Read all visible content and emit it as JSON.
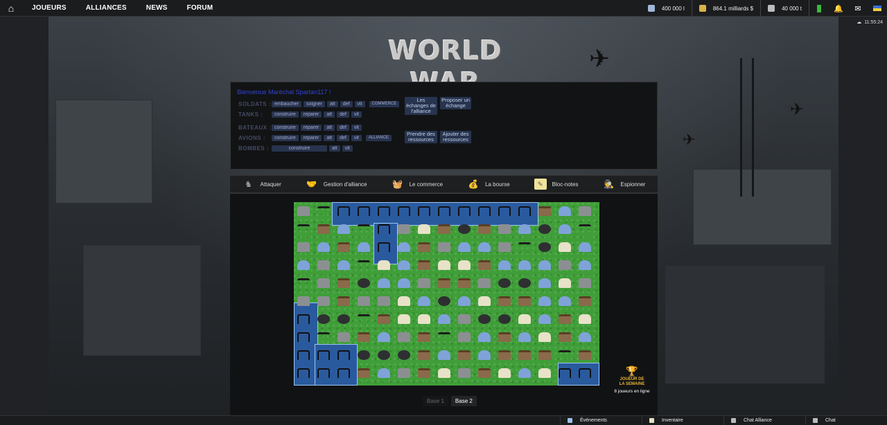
{
  "nav": {
    "home_label": "⌂",
    "items": [
      "JOUEURS",
      "ALLIANCES",
      "NEWS",
      "FORUM"
    ]
  },
  "resources": {
    "oil": "400 000 l",
    "money": "864.1 milliards $",
    "steel": "40 000 t"
  },
  "clock": "11:55:24",
  "logo_text": "WORLD WAR",
  "panel": {
    "welcome": "Bienvenue Maréchal Spartan117 !",
    "rows": {
      "soldats": {
        "label": "SOLDATS :",
        "buttons": [
          "embaucher",
          "soigner",
          "att",
          "def",
          "vit",
          "COMMERCE"
        ]
      },
      "tanks": {
        "label": "TANKS :",
        "buttons": [
          "construire",
          "reparer",
          "att",
          "def",
          "vit"
        ]
      },
      "bateaux": {
        "label": "BATEAUX :",
        "buttons": [
          "construire",
          "reparer",
          "att",
          "def",
          "vit"
        ]
      },
      "avions": {
        "label": "AVIONS :",
        "buttons": [
          "construire",
          "reparer",
          "att",
          "def",
          "vit",
          "ALLIANCE"
        ]
      },
      "bombes": {
        "label": "BOMBES :",
        "buttons": [
          "construire",
          "att",
          "vit"
        ]
      }
    },
    "side_buttons": {
      "echanges": "Les échanges de l'alliance",
      "proposer": "Proposer un échange",
      "prendre": "Prendre des ressources",
      "ajouter": "Ajouter des ressources"
    }
  },
  "actions": [
    "Attaquer",
    "Gestion d'alliance",
    "Le commerce",
    "La bourse",
    "Bloc-notes",
    "Espionner"
  ],
  "joueur": {
    "line1": "JOUEUR DE",
    "line2": "LA SEMAINE",
    "online": "8 joueurs en ligne"
  },
  "bases": {
    "base1": "Base 1",
    "base2": "Base 2"
  },
  "bottom": [
    "Événements",
    "Inventaire",
    "Chat Alliance",
    "Chat"
  ],
  "colors": {
    "topbar": "#1b1c1e",
    "pill": "#27344f",
    "welcome": "#2f43d8",
    "grass": "#3f9e38",
    "water": "#2a5a9e"
  }
}
